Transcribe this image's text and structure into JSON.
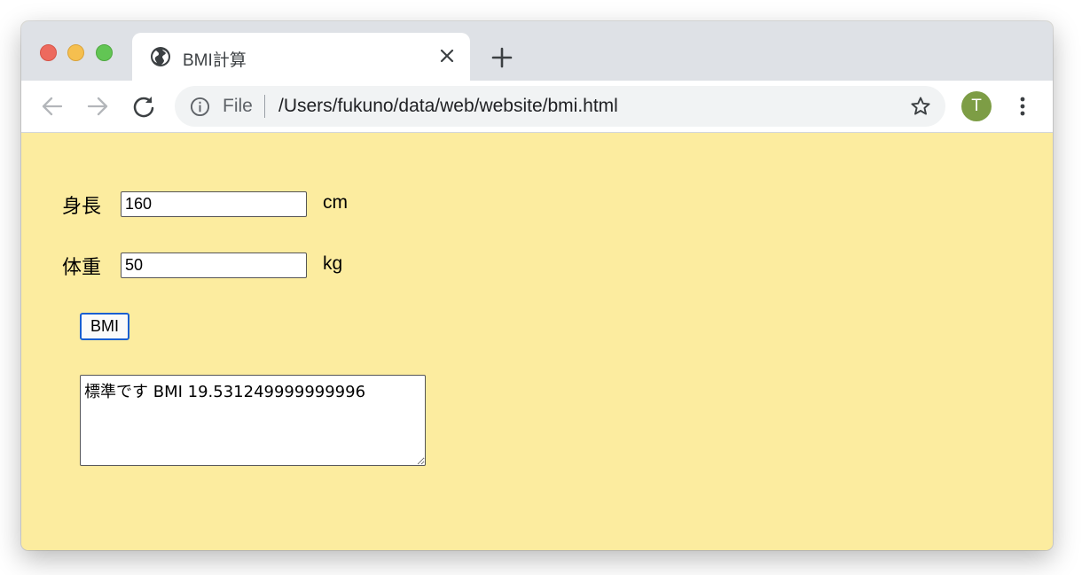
{
  "browser": {
    "tab": {
      "title": "BMI計算",
      "favicon": "globe-icon"
    },
    "toolbar": {
      "scheme_label": "File",
      "url": "/Users/fukuno/data/web/website/bmi.html",
      "profile_initial": "T",
      "profile_color": "#7d9d45"
    }
  },
  "page": {
    "background_color": "#fcec9f",
    "height": {
      "label": "身長",
      "value": "160",
      "unit": "cm"
    },
    "weight": {
      "label": "体重",
      "value": "50",
      "unit": "kg"
    },
    "button_label": "BMI",
    "result_text": "標準です BMI 19.531249999999996"
  }
}
